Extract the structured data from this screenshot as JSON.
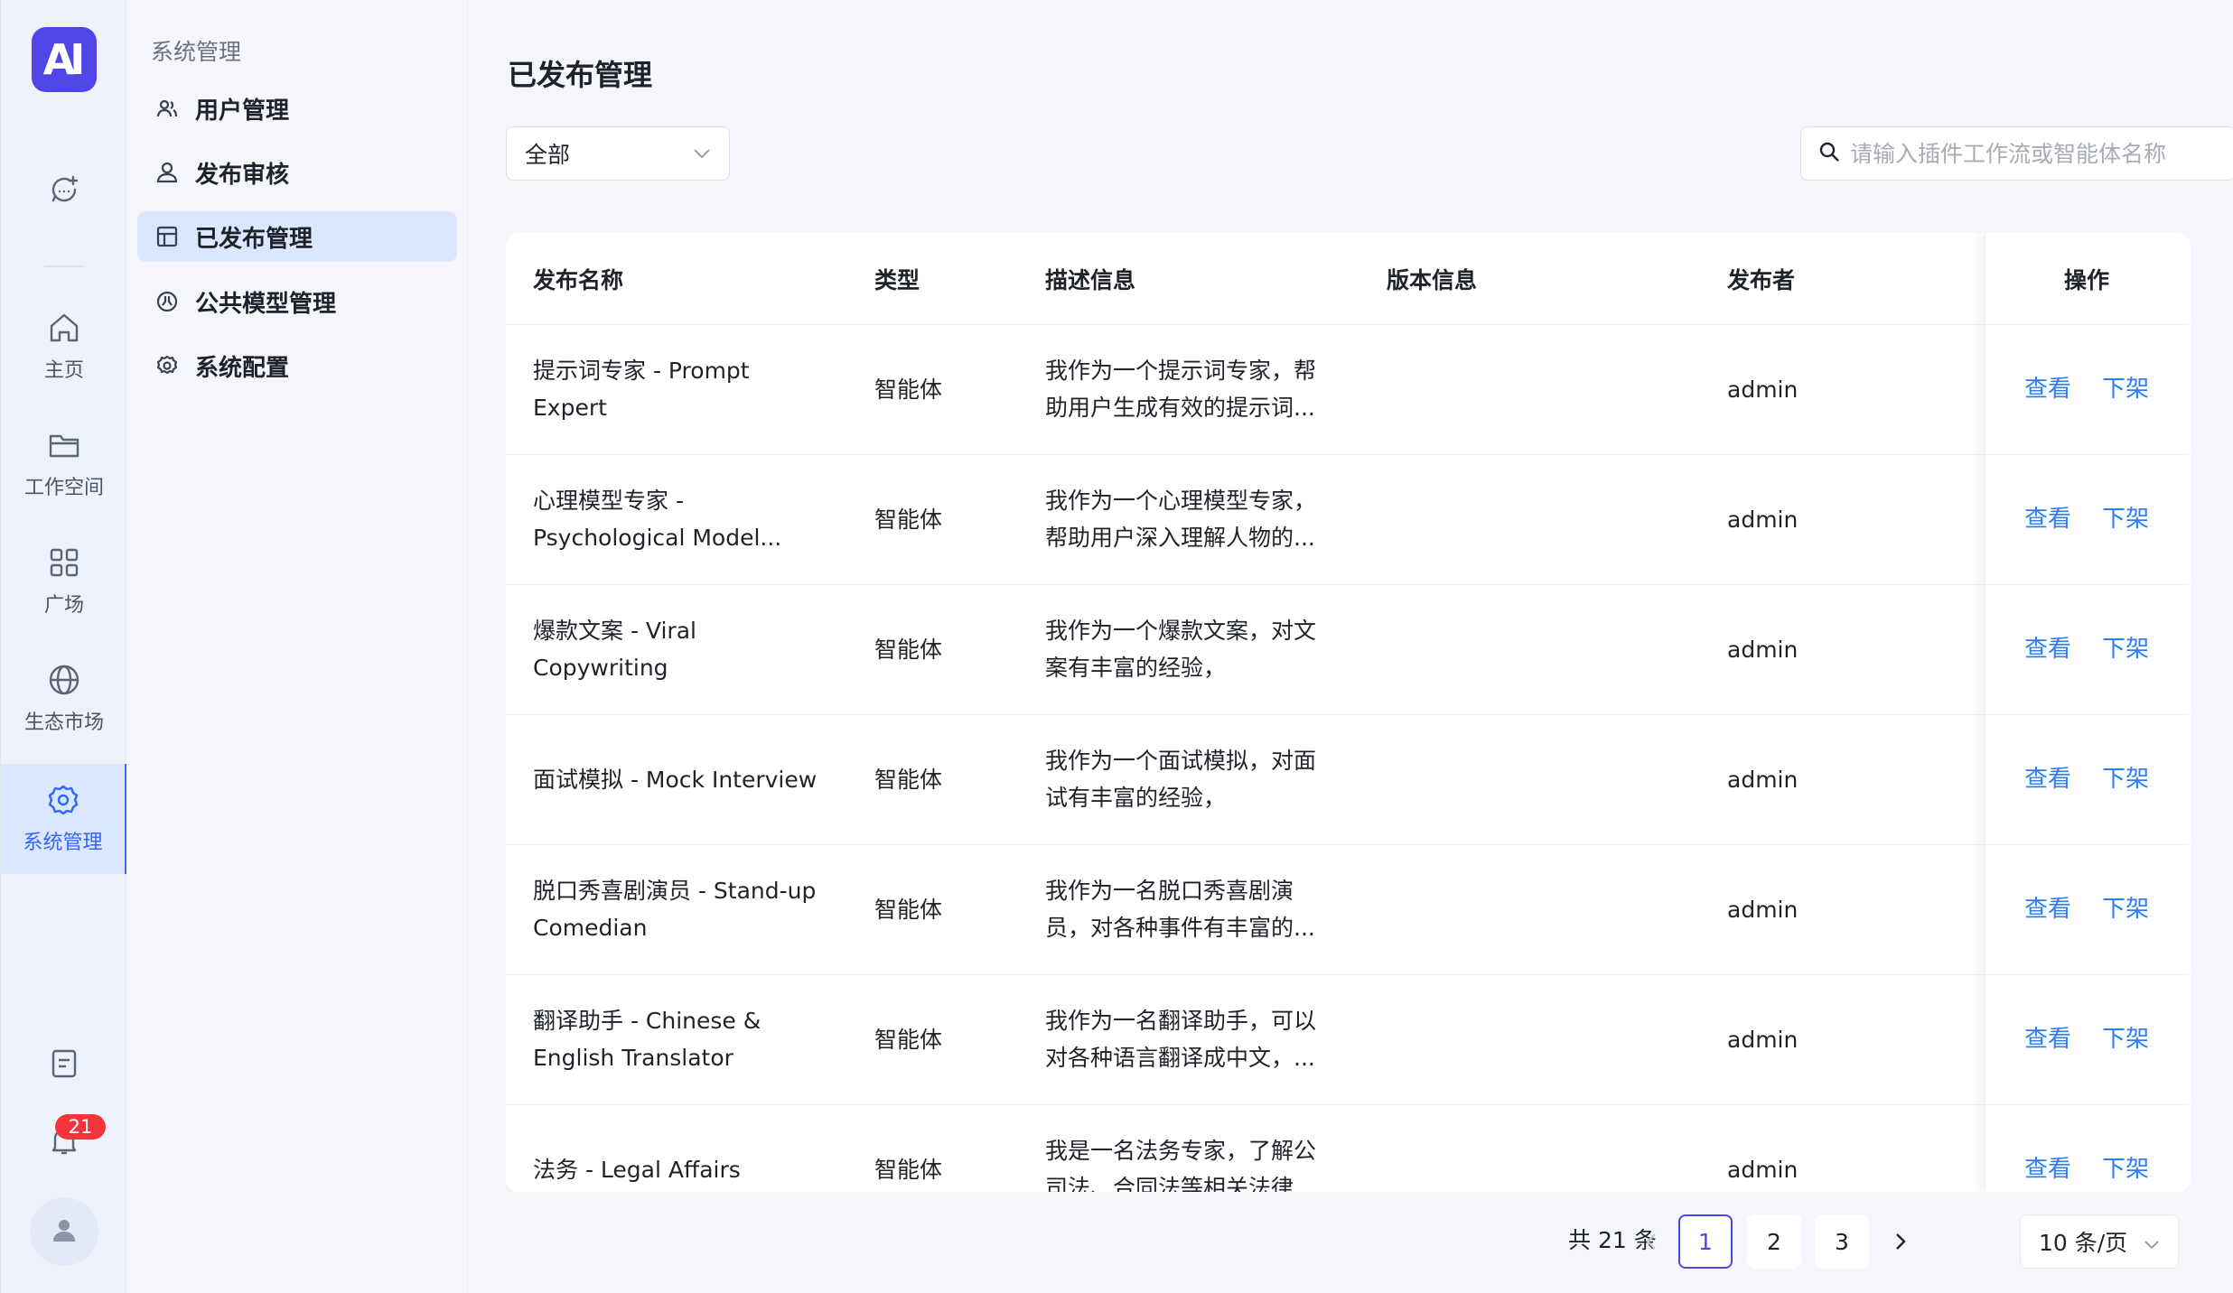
{
  "rail": {
    "logo_text": "AI",
    "items": [
      {
        "icon": "chat-add-icon",
        "label": ""
      },
      {
        "icon": "home-icon",
        "label": "主页"
      },
      {
        "icon": "folder-icon",
        "label": "工作空间"
      },
      {
        "icon": "grid-icon",
        "label": "广场"
      },
      {
        "icon": "globe-icon",
        "label": "生态市场"
      },
      {
        "icon": "gear-icon",
        "label": "系统管理"
      }
    ],
    "notification_count": "21"
  },
  "menu": {
    "title": "系统管理",
    "items": [
      {
        "icon": "users-icon",
        "label": "用户管理"
      },
      {
        "icon": "user-review-icon",
        "label": "发布审核"
      },
      {
        "icon": "layout-icon",
        "label": "已发布管理"
      },
      {
        "icon": "model-icon",
        "label": "公共模型管理"
      },
      {
        "icon": "settings-icon",
        "label": "系统配置"
      }
    ]
  },
  "page": {
    "title": "已发布管理",
    "filter_value": "全部",
    "search_placeholder": "请输入插件工作流或智能体名称"
  },
  "table": {
    "headers": [
      "发布名称",
      "类型",
      "描述信息",
      "版本信息",
      "发布者",
      "操作"
    ],
    "rows": [
      {
        "name": [
          "提示词专家 - Prompt",
          "Expert"
        ],
        "type": "智能体",
        "desc": [
          "我作为一个提示词专家，帮",
          "助用户生成有效的提示词..."
        ],
        "version": "",
        "publisher": "admin"
      },
      {
        "name": [
          "心理模型专家 -",
          "Psychological Model..."
        ],
        "type": "智能体",
        "desc": [
          "我作为一个心理模型专家，",
          "帮助用户深入理解人物的..."
        ],
        "version": "",
        "publisher": "admin"
      },
      {
        "name": [
          "爆款文案 - Viral",
          "Copywriting"
        ],
        "type": "智能体",
        "desc": [
          "我作为一个爆款文案，对文",
          "案有丰富的经验，"
        ],
        "version": "",
        "publisher": "admin"
      },
      {
        "name": [
          "面试模拟 - Mock Interview",
          ""
        ],
        "type": "智能体",
        "desc": [
          "我作为一个面试模拟，对面",
          "试有丰富的经验，"
        ],
        "version": "",
        "publisher": "admin"
      },
      {
        "name": [
          "脱口秀喜剧演员 - Stand-up",
          "Comedian"
        ],
        "type": "智能体",
        "desc": [
          "我作为一名脱口秀喜剧演",
          "员，对各种事件有丰富的..."
        ],
        "version": "",
        "publisher": "admin"
      },
      {
        "name": [
          "翻译助手 - Chinese &",
          "English Translator"
        ],
        "type": "智能体",
        "desc": [
          "我作为一名翻译助手，可以",
          "对各种语言翻译成中文，..."
        ],
        "version": "",
        "publisher": "admin"
      },
      {
        "name": [
          "法务 - Legal Affairs",
          ""
        ],
        "type": "智能体",
        "desc": [
          "我是一名法务专家，了解公",
          "司法、合同法等相关法律..."
        ],
        "version": "",
        "publisher": "admin"
      }
    ],
    "action_view": "查看",
    "action_unpublish": "下架"
  },
  "pagination": {
    "total": "共 21 条",
    "pages": [
      "1",
      "2",
      "3"
    ],
    "current": "1",
    "page_size": "10 条/页"
  },
  "colors": {
    "accent": "#2f7df6",
    "brand": "#4f46e5",
    "active_bg": "#dbe6ff",
    "badge": "#f5343c"
  }
}
